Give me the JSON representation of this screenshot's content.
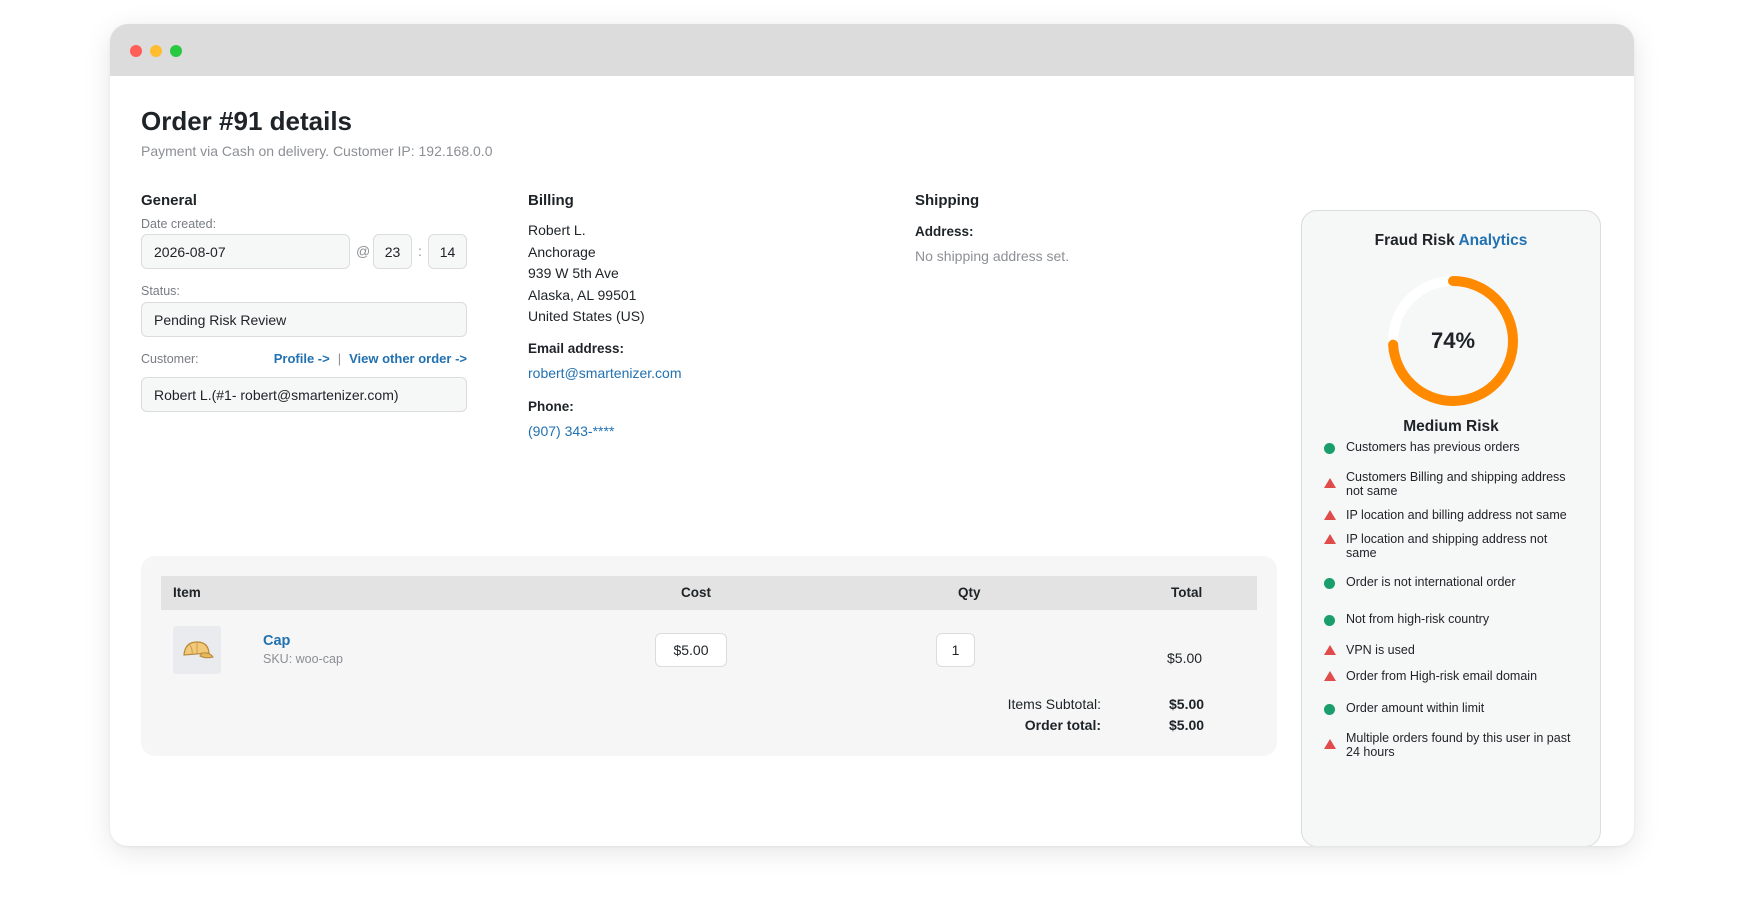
{
  "header": {
    "title": "Order #91 details",
    "subtitle": "Payment via Cash on delivery. Customer IP: 192.168.0.0"
  },
  "general": {
    "heading": "General",
    "date_label": "Date created:",
    "date_value": "2026-08-07",
    "at_symbol": "@",
    "hour": "23",
    "colon": ":",
    "minute": "14",
    "status_label": "Status:",
    "status_value": "Pending Risk Review",
    "customer_label": "Customer:",
    "profile_link": "Profile ->",
    "link_separator": "|",
    "view_orders_link": "View other order ->",
    "customer_value": "Robert L.(#1- robert@smartenizer.com)"
  },
  "billing": {
    "heading": "Billing",
    "address_lines": [
      "Robert L.",
      "Anchorage",
      "939 W 5th Ave",
      "Alaska, AL 99501",
      "United States (US)"
    ],
    "email_label": "Email address:",
    "email": "robert@smartenizer.com",
    "phone_label": "Phone:",
    "phone": "(907) 343-****"
  },
  "shipping": {
    "heading": "Shipping",
    "address_label": "Address:",
    "address_value": "No shipping address set."
  },
  "items": {
    "columns": {
      "item": "Item",
      "cost": "Cost",
      "qty": "Qty",
      "total": "Total"
    },
    "rows": [
      {
        "name": "Cap",
        "sku": "SKU: woo-cap",
        "cost": "$5.00",
        "qty": "1",
        "total": "$5.00",
        "icon": "cap-icon"
      }
    ],
    "subtotal_label": "Items Subtotal:",
    "subtotal_value": "$5.00",
    "order_total_label": "Order total:",
    "order_total_value": "$5.00"
  },
  "fraud": {
    "title_main": "Fraud Risk",
    "title_accent": "Analytics",
    "score_text": "74%",
    "score": 0.74,
    "level": "Medium Risk",
    "colors": {
      "good": "#1a9e6b",
      "bad": "#e04b4b",
      "gauge": "#ff8a00",
      "gauge_track": "#ffffff",
      "accent": "#2271b1"
    },
    "checks": [
      {
        "text": "Customers has previous orders",
        "status": "good"
      },
      {
        "text": "Customers Billing and shipping address not same",
        "status": "bad"
      },
      {
        "text": "IP location and billing address not same",
        "status": "bad"
      },
      {
        "text": "IP location and shipping address not same",
        "status": "bad"
      },
      {
        "text": "Order is not international order",
        "status": "good"
      },
      {
        "text": "Not from high-risk country",
        "status": "good"
      },
      {
        "text": "VPN is used",
        "status": "bad"
      },
      {
        "text": "Order from High-risk email domain",
        "status": "bad"
      },
      {
        "text": "Order amount within limit",
        "status": "good"
      },
      {
        "text": "Multiple orders found by this user in past 24 hours",
        "status": "bad"
      }
    ]
  }
}
